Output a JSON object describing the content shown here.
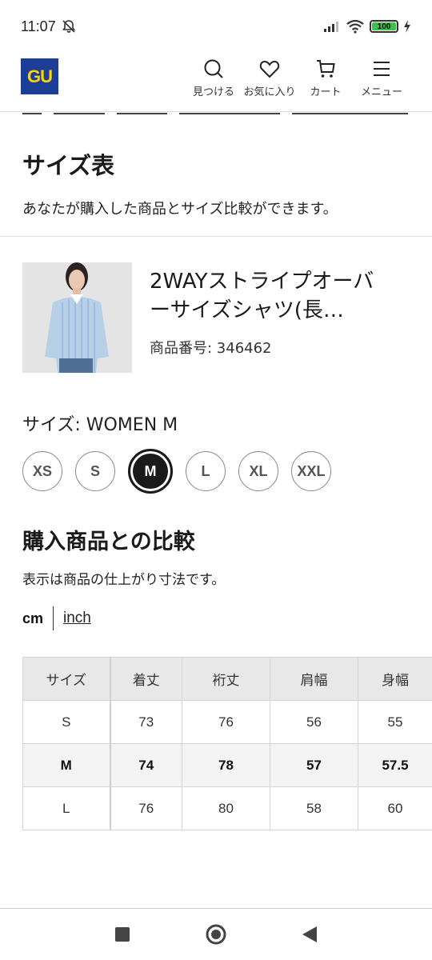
{
  "status": {
    "time": "11:07",
    "battery": "100",
    "battery_level": 1.0
  },
  "header": {
    "logo": "GU",
    "nav": [
      {
        "label": "見つける",
        "icon": "search-icon"
      },
      {
        "label": "お気に入り",
        "icon": "heart-icon"
      },
      {
        "label": "カート",
        "icon": "cart-icon"
      },
      {
        "label": "メニュー",
        "icon": "menu-icon"
      }
    ]
  },
  "size_chart": {
    "title": "サイズ表",
    "description": "あなたが購入した商品とサイズ比較ができます。"
  },
  "product": {
    "name": "2WAYストライプオーバーサイズシャツ(長…",
    "name_line1": "2WAYストライプオーバ",
    "name_line2": "ーサイズシャツ(長…",
    "code": "商品番号: 346462"
  },
  "size_selector": {
    "label": "サイズ: WOMEN M",
    "options": [
      "XS",
      "S",
      "M",
      "L",
      "XL",
      "XXL"
    ],
    "selected": "M"
  },
  "comparison": {
    "title": "購入商品との比較",
    "description": "表示は商品の仕上がり寸法です。",
    "units": {
      "active": "cm",
      "inactive": "inch"
    },
    "headers": [
      "サイズ",
      "着丈",
      "裄丈",
      "肩幅",
      "身幅"
    ],
    "rows": [
      {
        "size": "S",
        "values": [
          "73",
          "76",
          "56",
          "55"
        ],
        "highlight": false
      },
      {
        "size": "M",
        "values": [
          "74",
          "78",
          "57",
          "57.5"
        ],
        "highlight": true
      },
      {
        "size": "L",
        "values": [
          "76",
          "80",
          "58",
          "60"
        ],
        "highlight": false
      }
    ]
  },
  "colors": {
    "logo_bg": "#1c3e96",
    "logo_text": "#ffd400",
    "battery_green": "#3cc24a"
  }
}
